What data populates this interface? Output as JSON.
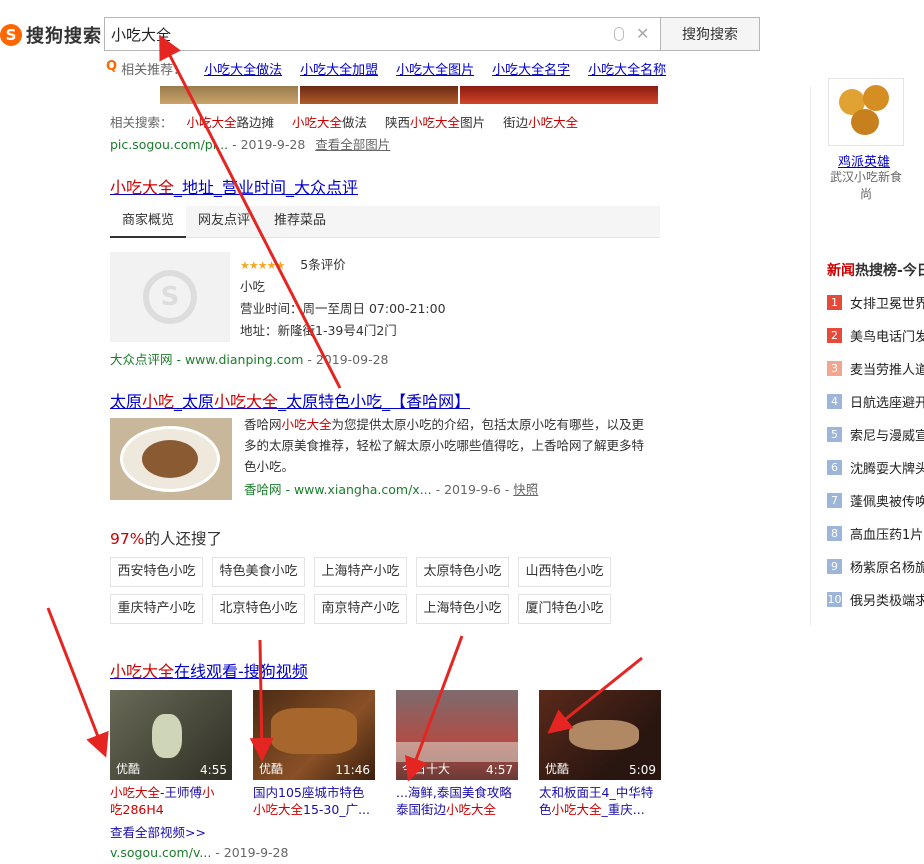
{
  "header": {
    "logo_text": "搜狗搜索",
    "logo_letter": "S",
    "query": "小吃大全",
    "search_button": "搜狗搜索",
    "related_label": "相关推荐：",
    "related": [
      "小吃大全做法",
      "小吃大全加盟",
      "小吃大全图片",
      "小吃大全名字",
      "小吃大全名称"
    ]
  },
  "image_result": {
    "related_label": "相关搜索：",
    "related": [
      {
        "hl": "小吃大全",
        "rest": "路边摊"
      },
      {
        "hl": "小吃大全",
        "rest": "做法"
      },
      {
        "pre": "陕西",
        "hl": "小吃大全",
        "rest": "图片"
      },
      {
        "pre": "街边",
        "hl": "小吃大全",
        "rest": ""
      }
    ],
    "url": "pic.sogou.com/pi...",
    "date": " - 2019-9-28",
    "all_images": "查看全部图片"
  },
  "dianping": {
    "title_hl": "小吃大全",
    "title_rest": "_地址_营业时间_大众点评",
    "tabs": [
      "商家概览",
      "网友点评",
      "推荐菜品"
    ],
    "stars": "★★★★★",
    "reviews": "5条评价",
    "category": "小吃",
    "hours": "营业时间：周一至周日 07:00-21:00",
    "address": "地址：新隆街1-39号4门2门",
    "source": "大众点评网 - www.dianping.com",
    "date": " - 2019-09-28"
  },
  "xiangha": {
    "title_parts": [
      {
        "t": "太原",
        "hl": false
      },
      {
        "t": "小吃",
        "hl": true
      },
      {
        "t": "_太原",
        "hl": false
      },
      {
        "t": "小吃大全",
        "hl": true
      },
      {
        "t": "_太原特色小吃_【香哈网】",
        "hl": false
      }
    ],
    "snippet_pre": "香哈网",
    "snippet_hl": "小吃大全",
    "snippet_rest": "为您提供太原小吃的介绍，包括太原小吃有哪些，以及更多的太原美食推荐，轻松了解太原小吃哪些值得吃，上香哈网了解更多特色小吃。",
    "source": "香哈网 - www.xiangha.com/x...",
    "date": " - 2019-9-6 - ",
    "snapshot": "快照"
  },
  "also": {
    "pct": "97%",
    "label": "的人还搜了",
    "tags": [
      [
        "西安特色小吃",
        "特色美食小吃",
        "上海特产小吃",
        "太原特色小吃",
        "山西特色小吃"
      ],
      [
        "重庆特产小吃",
        "北京特色小吃",
        "南京特产小吃",
        "上海特色小吃",
        "厦门特色小吃"
      ]
    ]
  },
  "videos": {
    "title_hl": "小吃大全",
    "title_rest": "在线观看-搜狗视频",
    "items": [
      {
        "src": "优酷",
        "dur": "4:55",
        "cap": [
          {
            "t": "小吃大全",
            "hl": true
          },
          {
            "t": "-王师傅",
            "hl": false
          },
          {
            "t": "小",
            "hl": true
          },
          {
            "t": "吃286H4",
            "hl": false
          }
        ]
      },
      {
        "src": "优酷",
        "dur": "11:46",
        "cap": [
          {
            "t": "国内105座城市特色",
            "hl": false
          },
          {
            "t": "小吃大全",
            "hl": true
          },
          {
            "t": "15-30_广...",
            "hl": false
          }
        ]
      },
      {
        "src": "今日十大",
        "dur": "4:57",
        "cap": [
          {
            "t": "...海鲜,泰国美食攻略",
            "hl": false
          },
          {
            "t": "泰国街边",
            "hl": false
          },
          {
            "t": "小吃大全",
            "hl": true
          }
        ]
      },
      {
        "src": "优酷",
        "dur": "5:09",
        "cap": [
          {
            "t": "太和板面王4_中华特",
            "hl": false
          },
          {
            "t": "色",
            "hl": false
          },
          {
            "t": "小吃大全",
            "hl": true
          },
          {
            "t": "_重庆...",
            "hl": false
          }
        ]
      }
    ],
    "all": "查看全部视频>>",
    "url": "v.sogou.com/v...",
    "date": " - 2019-9-28"
  },
  "sidebar": {
    "food_name": "鸡派英雄",
    "food_desc": "武汉小吃新食尚",
    "hot_title_red": "新闻",
    "hot_title_rest": "热搜榜-今日",
    "hot": [
      {
        "n": "1",
        "t": "女排卫冕世界"
      },
      {
        "n": "2",
        "t": "美鸟电话门发"
      },
      {
        "n": "3",
        "t": "麦当劳推人道"
      },
      {
        "n": "4",
        "t": "日航选座避开"
      },
      {
        "n": "5",
        "t": "索尼与漫威宣"
      },
      {
        "n": "6",
        "t": "沈腾耍大牌头"
      },
      {
        "n": "7",
        "t": "蓬佩奥被传唤"
      },
      {
        "n": "8",
        "t": "高血压药1片1"
      },
      {
        "n": "9",
        "t": "杨紫原名杨旎"
      },
      {
        "n": "10",
        "t": "俄另类极端求"
      }
    ]
  },
  "colors": {
    "highlight": "#cc0000",
    "link": "#0000cc",
    "url_green": "#1b7d2a",
    "rank_top": "#e64a3b",
    "rank_3": "#f2a58f",
    "rank_rest": "#9db5d8",
    "arrow": "#e52521"
  }
}
